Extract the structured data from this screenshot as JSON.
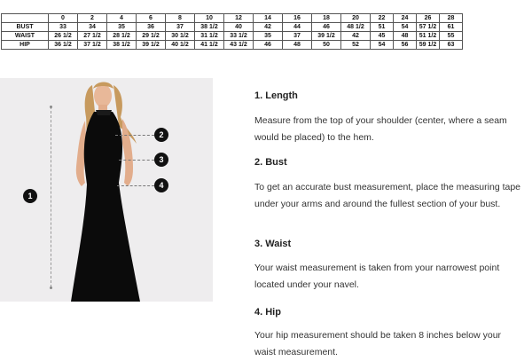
{
  "size_chart": {
    "sizes": [
      "0",
      "2",
      "4",
      "6",
      "8",
      "10",
      "12",
      "14",
      "16",
      "18",
      "20",
      "22",
      "24",
      "26",
      "28"
    ],
    "rows": [
      {
        "label": "BUST",
        "values": [
          "33",
          "34",
          "35",
          "36",
          "37",
          "38 1/2",
          "40",
          "42",
          "44",
          "46",
          "48 1/2",
          "51",
          "54",
          "57 1/2",
          "61"
        ]
      },
      {
        "label": "WAIST",
        "values": [
          "26 1/2",
          "27 1/2",
          "28 1/2",
          "29 1/2",
          "30 1/2",
          "31 1/2",
          "33 1/2",
          "35",
          "37",
          "39 1/2",
          "42",
          "45",
          "48",
          "51 1/2",
          "55"
        ]
      },
      {
        "label": "HIP",
        "values": [
          "36 1/2",
          "37 1/2",
          "38 1/2",
          "39 1/2",
          "40 1/2",
          "41 1/2",
          "43 1/2",
          "46",
          "48",
          "50",
          "52",
          "54",
          "56",
          "59 1/2",
          "63"
        ]
      }
    ]
  },
  "figure": {
    "markers": [
      "1",
      "2",
      "3",
      "4"
    ]
  },
  "guide": {
    "length": {
      "title": "1. Length",
      "text": "Measure from the top of your shoulder (center, where a seam would be placed) to the hem."
    },
    "bust": {
      "title": "2. Bust",
      "text": "To get an accurate bust measurement, place the measuring tape under your arms and around the fullest section of your bust."
    },
    "waist": {
      "title": "3. Waist",
      "text": "Your waist measurement is taken from your narrowest point located under your navel."
    },
    "hip": {
      "title": "4. Hip",
      "text": "Your hip measurement should be taken 8 inches below your waist measurement."
    }
  }
}
